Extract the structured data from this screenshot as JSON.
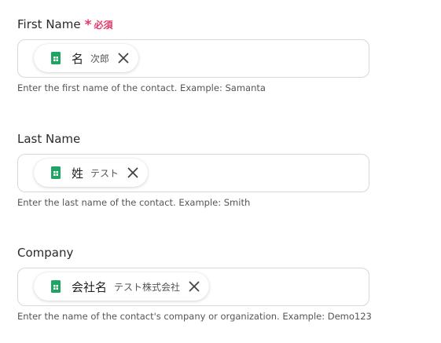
{
  "fields": [
    {
      "label": "First Name",
      "required_mark": "*",
      "required_text": "必須",
      "chip_main": "名",
      "chip_sub": "次郎",
      "help": "Enter the first name of the contact. Example: Samanta"
    },
    {
      "label": "Last Name",
      "chip_main": "姓",
      "chip_sub": "テスト",
      "help": "Enter the last name of the contact. Example: Smith"
    },
    {
      "label": "Company",
      "chip_main": "会社名",
      "chip_sub": "テスト株式会社",
      "help": "Enter the name of the contact's company or organization. Example: Demo123"
    }
  ],
  "colors": {
    "required": "#e5396a",
    "sheets_green": "#1fa463",
    "border": "#d5d8dc"
  },
  "icons": {
    "chip_icon": "google-sheets-icon",
    "remove_icon": "close-icon"
  }
}
